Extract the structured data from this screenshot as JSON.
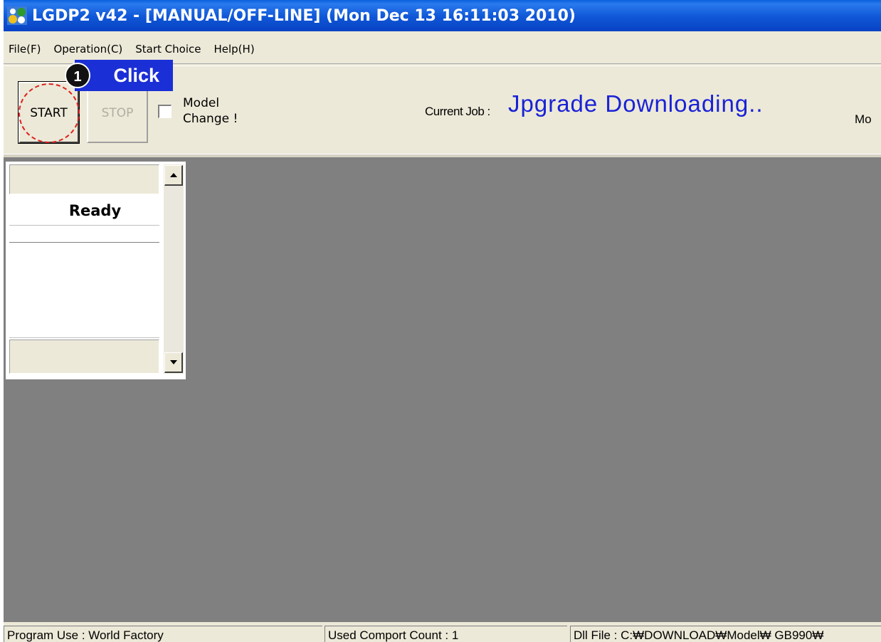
{
  "window": {
    "title": "LGDP2 v42 - [MANUAL/OFF-LINE] (Mon Dec 13 16:11:03 2010)"
  },
  "menu": {
    "items": [
      {
        "label": "File(F)"
      },
      {
        "label": "Operation(C)"
      },
      {
        "label": "Start Choice"
      },
      {
        "label": "Help(H)"
      }
    ]
  },
  "toolbar": {
    "start_label": "START",
    "stop_label": "STOP",
    "model_change_line1": "Model",
    "model_change_line2": "Change !",
    "model_change_checked": false,
    "current_job_label": "Current Job :",
    "current_job_value": "Jpgrade Downloading..",
    "cut_off_label": "Mo"
  },
  "callout": {
    "step_number": "1",
    "text": "Click",
    "color": "#1b2fd6"
  },
  "panel": {
    "status": "Ready"
  },
  "statusbar": {
    "program_use": "Program Use : World Factory",
    "comport_count": "Used Comport Count : 1",
    "dll_file": "Dll File : C:₩DOWNLOAD₩Model₩ GB990₩"
  },
  "colors": {
    "titlebar": "#0a5fdd",
    "workspace": "#808080",
    "current_job_text": "#1a22d6",
    "highlight": "#e02020"
  }
}
